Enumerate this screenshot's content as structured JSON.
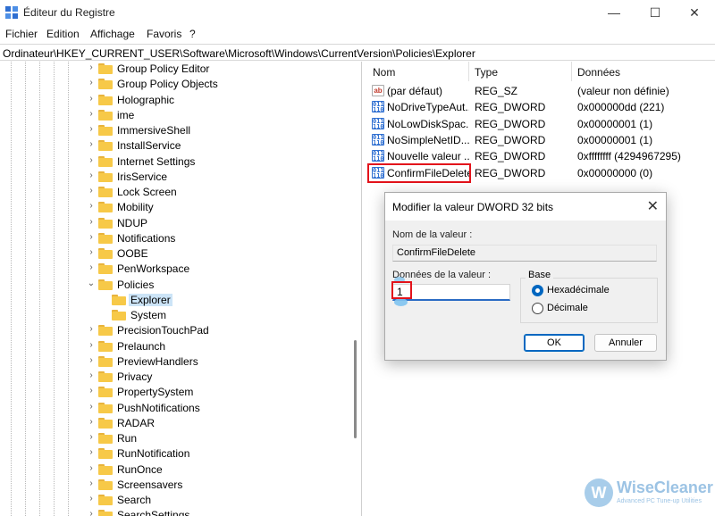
{
  "window": {
    "title": "Éditeur du Registre",
    "minimize_glyph": "—",
    "maximize_glyph": "☐",
    "close_glyph": "✕"
  },
  "menu": [
    "Fichier",
    "Edition",
    "Affichage",
    "Favoris",
    "?"
  ],
  "address": "Ordinateur\\HKEY_CURRENT_USER\\Software\\Microsoft\\Windows\\CurrentVersion\\Policies\\Explorer",
  "tree": {
    "items": [
      {
        "label": "Group Policy Editor",
        "expanded": false,
        "depth": 0
      },
      {
        "label": "Group Policy Objects",
        "expanded": false,
        "depth": 0
      },
      {
        "label": "Holographic",
        "expanded": false,
        "depth": 0
      },
      {
        "label": "ime",
        "expanded": false,
        "depth": 0
      },
      {
        "label": "ImmersiveShell",
        "expanded": false,
        "depth": 0
      },
      {
        "label": "InstallService",
        "expanded": false,
        "depth": 0
      },
      {
        "label": "Internet Settings",
        "expanded": false,
        "depth": 0
      },
      {
        "label": "IrisService",
        "expanded": false,
        "depth": 0
      },
      {
        "label": "Lock Screen",
        "expanded": false,
        "depth": 0
      },
      {
        "label": "Mobility",
        "expanded": false,
        "depth": 0
      },
      {
        "label": "NDUP",
        "expanded": false,
        "depth": 0
      },
      {
        "label": "Notifications",
        "expanded": false,
        "depth": 0
      },
      {
        "label": "OOBE",
        "expanded": false,
        "depth": 0
      },
      {
        "label": "PenWorkspace",
        "expanded": false,
        "depth": 0
      },
      {
        "label": "Policies",
        "expanded": true,
        "depth": 0
      },
      {
        "label": "Explorer",
        "expanded": null,
        "depth": 1,
        "selected": true
      },
      {
        "label": "System",
        "expanded": null,
        "depth": 1
      },
      {
        "label": "PrecisionTouchPad",
        "expanded": false,
        "depth": 0
      },
      {
        "label": "Prelaunch",
        "expanded": false,
        "depth": 0
      },
      {
        "label": "PreviewHandlers",
        "expanded": false,
        "depth": 0
      },
      {
        "label": "Privacy",
        "expanded": false,
        "depth": 0
      },
      {
        "label": "PropertySystem",
        "expanded": false,
        "depth": 0
      },
      {
        "label": "PushNotifications",
        "expanded": false,
        "depth": 0
      },
      {
        "label": "RADAR",
        "expanded": false,
        "depth": 0
      },
      {
        "label": "Run",
        "expanded": false,
        "depth": 0
      },
      {
        "label": "RunNotification",
        "expanded": false,
        "depth": 0
      },
      {
        "label": "RunOnce",
        "expanded": false,
        "depth": 0
      },
      {
        "label": "Screensavers",
        "expanded": false,
        "depth": 0
      },
      {
        "label": "Search",
        "expanded": false,
        "depth": 0
      },
      {
        "label": "SearchSettings",
        "expanded": false,
        "depth": 0
      }
    ]
  },
  "list": {
    "columns": [
      "Nom",
      "Type",
      "Données"
    ],
    "rows": [
      {
        "name": "(par défaut)",
        "type": "REG_SZ",
        "data": "(valeur non définie)",
        "icon": "string-value-icon",
        "icon_text": "ab"
      },
      {
        "name": "NoDriveTypeAut...",
        "type": "REG_DWORD",
        "data": "0x000000dd (221)",
        "icon": "dword-value-icon",
        "icon_text": "011\n110"
      },
      {
        "name": "NoLowDiskSpac...",
        "type": "REG_DWORD",
        "data": "0x00000001 (1)",
        "icon": "dword-value-icon",
        "icon_text": "011\n110"
      },
      {
        "name": "NoSimpleNetID...",
        "type": "REG_DWORD",
        "data": "0x00000001 (1)",
        "icon": "dword-value-icon",
        "icon_text": "011\n110"
      },
      {
        "name": "Nouvelle valeur ...",
        "type": "REG_DWORD",
        "data": "0xffffffff (4294967295)",
        "icon": "dword-value-icon",
        "icon_text": "011\n110"
      },
      {
        "name": "ConfirmFileDelete",
        "type": "REG_DWORD",
        "data": "0x00000000 (0)",
        "icon": "dword-value-icon",
        "icon_text": "011\n110"
      }
    ]
  },
  "dialog": {
    "title": "Modifier la valeur DWORD 32 bits",
    "close_glyph": "✕",
    "name_label": "Nom de la valeur :",
    "name_value": "ConfirmFileDelete",
    "data_label": "Données de la valeur :",
    "data_value": "1",
    "base_label": "Base",
    "radio_hex": "Hexadécimale",
    "radio_dec": "Décimale",
    "selected_base": "hex",
    "ok_label": "OK",
    "cancel_label": "Annuler"
  },
  "watermark": {
    "logo_letter": "W",
    "name": "WiseCleaner",
    "tagline": "Advanced PC Tune-up Utilities"
  },
  "colors": {
    "accent": "#0067c0",
    "highlight_red": "#e3131b",
    "folder": "#f7c948",
    "selection": "#cce4f7"
  }
}
